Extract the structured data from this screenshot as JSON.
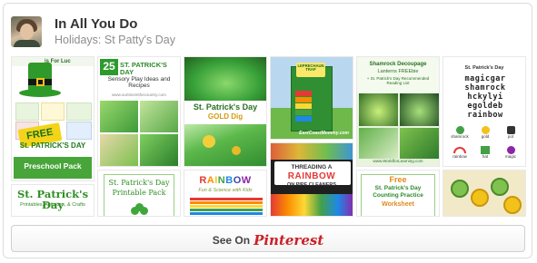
{
  "board": {
    "title": "In All You Do",
    "subtitle": "Holidays: St Patty's Day"
  },
  "pins": {
    "p1": {
      "top": "is For Luc",
      "label1": "FREE",
      "label2": "St. PATRICK'S DAY",
      "label3": "Preschool Pack"
    },
    "p1b": {
      "title": "St. Patrick's Day",
      "sub": "Printables, Activities, & Crafts"
    },
    "p2": {
      "number": "25",
      "title": "ST. PATRICK'S DAY",
      "sub": "Sensory Play Ideas and Recipes",
      "url": "www.ourtimeinthecountry.com"
    },
    "p2b": {
      "title": "St. Patrick's Day",
      "sub": "Printable Pack"
    },
    "p3": {
      "title": "St. Patrick's Day",
      "sub": "GOLD Dig"
    },
    "p3b": {
      "title": "RAINBOW",
      "sub": "Fun & Science with Kids"
    },
    "p4": {
      "badge": "LEPRECHAUN TRAP",
      "url": "EastCoastMommy.com"
    },
    "p4b": {
      "line1": "THREADING A",
      "line2": "RAINBOW",
      "line3": "ON PIPE CLEANERS"
    },
    "p5": {
      "title": "Shamrock Decoupage",
      "sub": "Lanterns FREEbie",
      "sub2": "+ St. Patrick's Day Recommended Reading List",
      "url": "www.WorldforLearning.com"
    },
    "p5b": {
      "line1": "Free",
      "line2": "St. Patrick's Day",
      "line3": "Counting Practice",
      "line4": "Worksheet"
    },
    "p6": {
      "header": "St. Patrick's Day",
      "rows": [
        "magicgar",
        "shamrock",
        "hckylyi",
        "egoldeb",
        "rainbow"
      ],
      "words": [
        "shamrock",
        "gold",
        "pot",
        "rainbow",
        "hat",
        "magic"
      ]
    }
  },
  "footer": {
    "see_on": "See On",
    "brand": "Pinterest"
  },
  "colors": {
    "pinterest_red": "#cb2027",
    "green": "#3a9a2a",
    "text_dark": "#333333",
    "text_muted": "#8d8d8d"
  }
}
